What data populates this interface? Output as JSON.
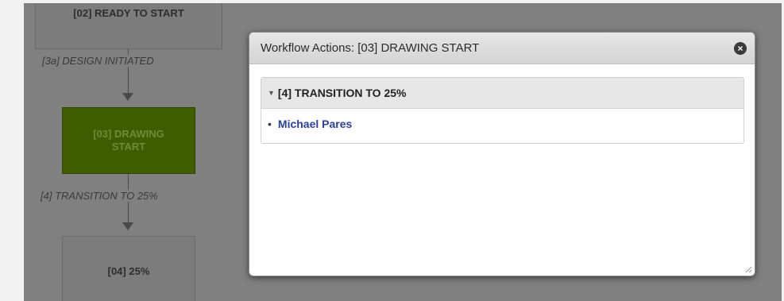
{
  "workflow": {
    "nodes": [
      {
        "label": "[02] READY TO START"
      },
      {
        "label_line1": "[03] DRAWING",
        "label_line2": "START",
        "color": "#3f5c00"
      },
      {
        "label": "[04] 25%"
      }
    ],
    "edges": [
      {
        "label": "[3a] DESIGN INITIATED"
      },
      {
        "label": "[4] TRANSITION TO 25%"
      }
    ]
  },
  "dialog": {
    "title": "Workflow Actions: [03] DRAWING START",
    "close_icon": "×",
    "section": {
      "header": "[4] TRANSITION TO 25%",
      "expand_icon": "▼",
      "items": [
        {
          "bullet": "•",
          "name": "Michael Pares"
        }
      ]
    }
  }
}
